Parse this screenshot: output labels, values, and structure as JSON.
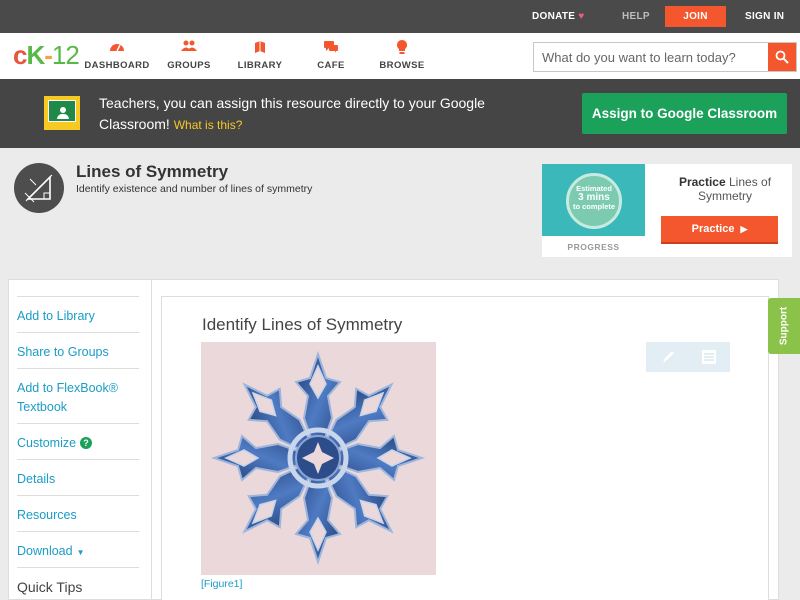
{
  "topbar": {
    "donate": "DONATE",
    "help": "HELP",
    "join": "JOIN",
    "signin": "SIGN IN"
  },
  "nav": {
    "logo_c": "c",
    "logo_k": "K",
    "logo_dash": "-",
    "logo_12": "12",
    "items": [
      {
        "label": "DASHBOARD",
        "icon": "dashboard-icon"
      },
      {
        "label": "GROUPS",
        "icon": "groups-icon"
      },
      {
        "label": "LIBRARY",
        "icon": "library-icon"
      },
      {
        "label": "CAFE",
        "icon": "cafe-icon"
      },
      {
        "label": "BROWSE",
        "icon": "browse-icon"
      }
    ],
    "search_placeholder": "What do you want to learn today?"
  },
  "banner": {
    "text": "Teachers, you can assign this resource directly to your Google Classroom!",
    "what": "What is this?",
    "assign_label": "Assign to Google Classroom"
  },
  "header": {
    "title": "Lines of Symmetry",
    "subtitle": "Identify existence and number of lines of symmetry"
  },
  "practice": {
    "estimated": "Estimated",
    "mins": "3 mins",
    "to_complete": "to complete",
    "progress_label": "PROGRESS",
    "title_bold": "Practice",
    "title_rest": "Lines of Symmetry",
    "button_label": "Practice"
  },
  "sidebar": {
    "items": [
      {
        "label": "Add to Library"
      },
      {
        "label": "Share to Groups"
      },
      {
        "label": "Add to FlexBook® Textbook"
      },
      {
        "label": "Customize"
      },
      {
        "label": "Details"
      },
      {
        "label": "Resources"
      },
      {
        "label": "Download"
      }
    ],
    "help_glyph": "?",
    "quick_tips": "Quick Tips"
  },
  "content": {
    "title": "Identify Lines of Symmetry",
    "figure_caption": "[Figure1]"
  },
  "support": {
    "label": "Support"
  },
  "colors": {
    "accent": "#f4572d",
    "green": "#1ca15a",
    "link": "#1a9cc6"
  }
}
